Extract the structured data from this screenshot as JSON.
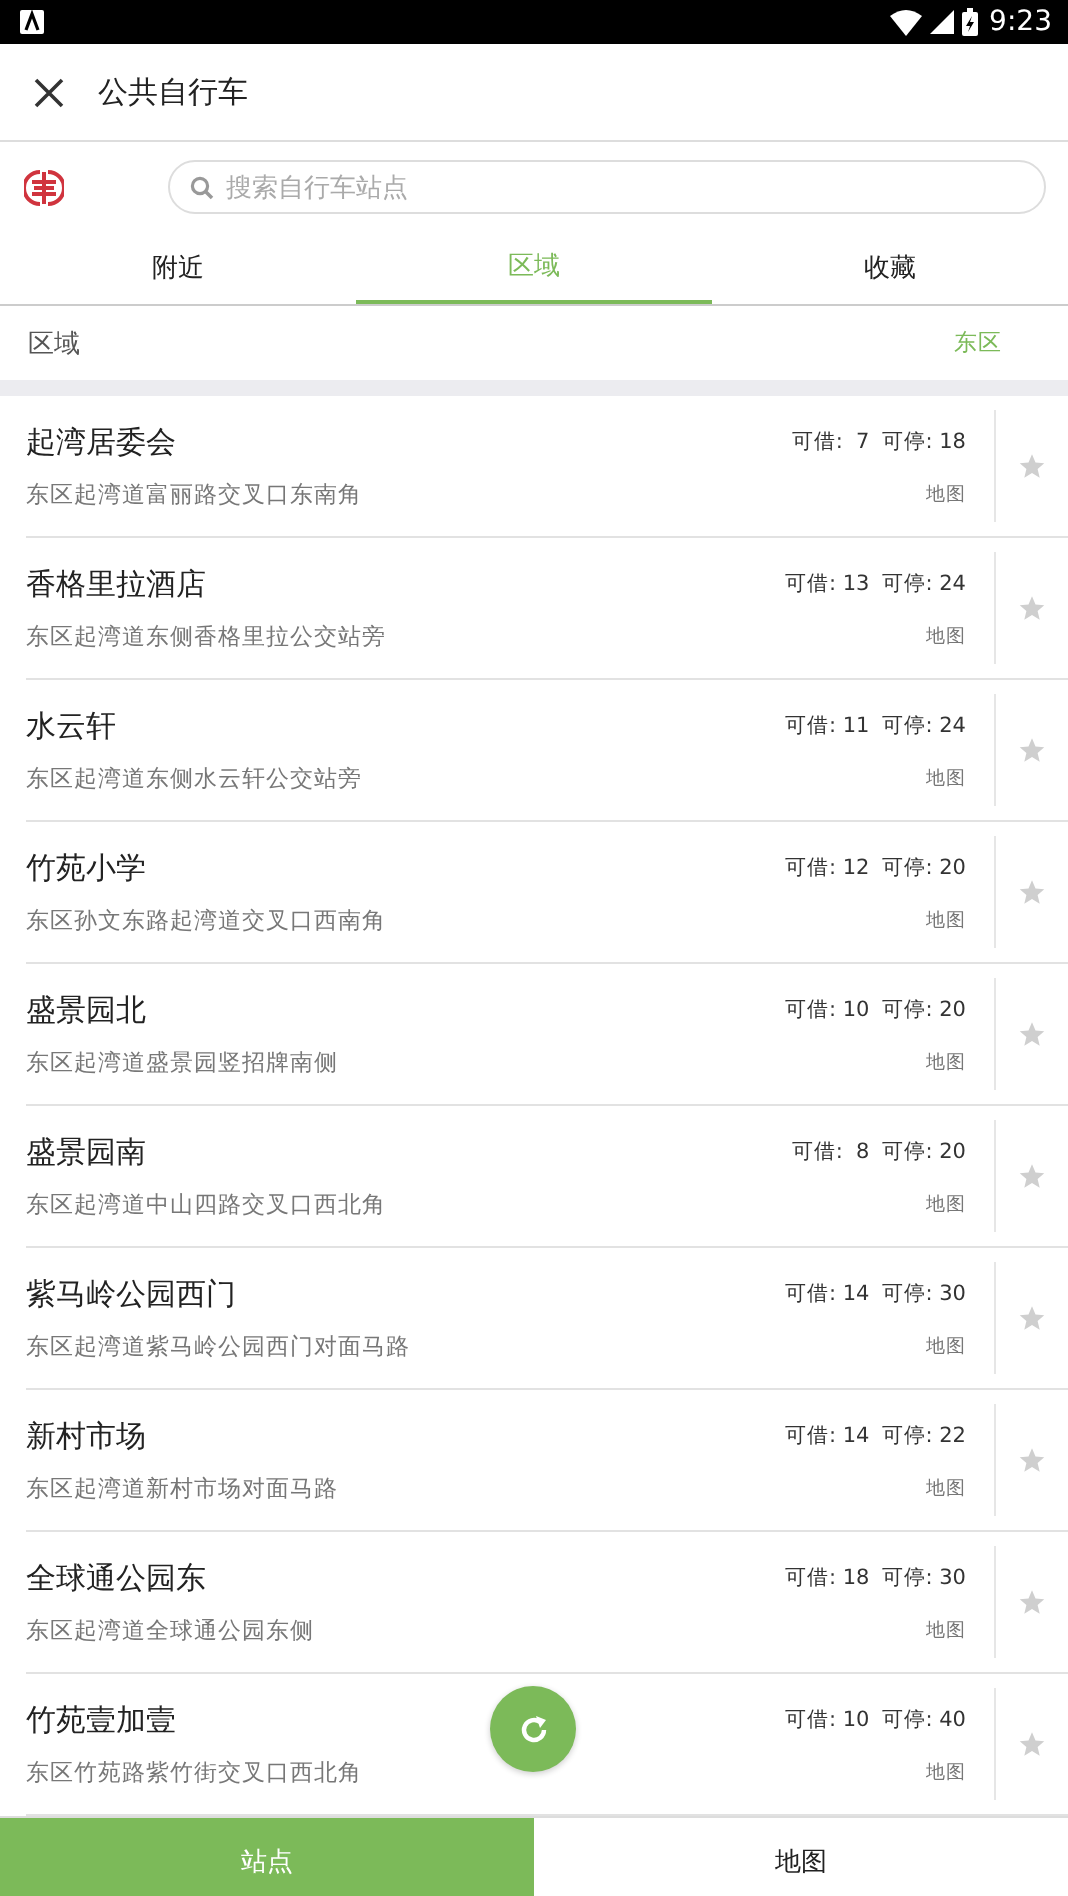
{
  "status_bar": {
    "time": "9:23"
  },
  "header": {
    "title": "公共自行车"
  },
  "search": {
    "placeholder": "搜索自行车站点"
  },
  "tabs": [
    {
      "label": "附近",
      "selected": false
    },
    {
      "label": "区域",
      "selected": true
    },
    {
      "label": "收藏",
      "selected": false
    }
  ],
  "filter": {
    "label": "区域",
    "value": "东区"
  },
  "stations": [
    {
      "name": "起湾居委会",
      "bikes": "可借:  7",
      "docks": "可停: 18",
      "address": "东区起湾道富丽路交叉口东南角",
      "map": "地图",
      "favorite": false
    },
    {
      "name": "香格里拉酒店",
      "bikes": "可借: 13",
      "docks": "可停: 24",
      "address": "东区起湾道东侧香格里拉公交站旁",
      "map": "地图",
      "favorite": false
    },
    {
      "name": "水云轩",
      "bikes": "可借: 11",
      "docks": "可停: 24",
      "address": "东区起湾道东侧水云轩公交站旁",
      "map": "地图",
      "favorite": false
    },
    {
      "name": "竹苑小学",
      "bikes": "可借: 12",
      "docks": "可停: 20",
      "address": "东区孙文东路起湾道交叉口西南角",
      "map": "地图",
      "favorite": false
    },
    {
      "name": "盛景园北",
      "bikes": "可借: 10",
      "docks": "可停: 20",
      "address": "东区起湾道盛景园竖招牌南侧",
      "map": "地图",
      "favorite": false
    },
    {
      "name": "盛景园南",
      "bikes": "可借:  8",
      "docks": "可停: 20",
      "address": "东区起湾道中山四路交叉口西北角",
      "map": "地图",
      "favorite": false
    },
    {
      "name": "紫马岭公园西门",
      "bikes": "可借: 14",
      "docks": "可停: 30",
      "address": "东区起湾道紫马岭公园西门对面马路",
      "map": "地图",
      "favorite": false
    },
    {
      "name": "新村市场",
      "bikes": "可借: 14",
      "docks": "可停: 22",
      "address": "东区起湾道新村市场对面马路",
      "map": "地图",
      "favorite": false
    },
    {
      "name": "全球通公园东",
      "bikes": "可借: 18",
      "docks": "可停: 30",
      "address": "东区起湾道全球通公园东侧",
      "map": "地图",
      "favorite": false
    },
    {
      "name": "竹苑壹加壹",
      "bikes": "可借: 10",
      "docks": "可停: 40",
      "address": "东区竹苑路紫竹街交叉口西北角",
      "map": "地图",
      "favorite": false
    }
  ],
  "bottom_tabs": [
    {
      "label": "站点",
      "selected": true
    },
    {
      "label": "地图",
      "selected": false
    }
  ]
}
